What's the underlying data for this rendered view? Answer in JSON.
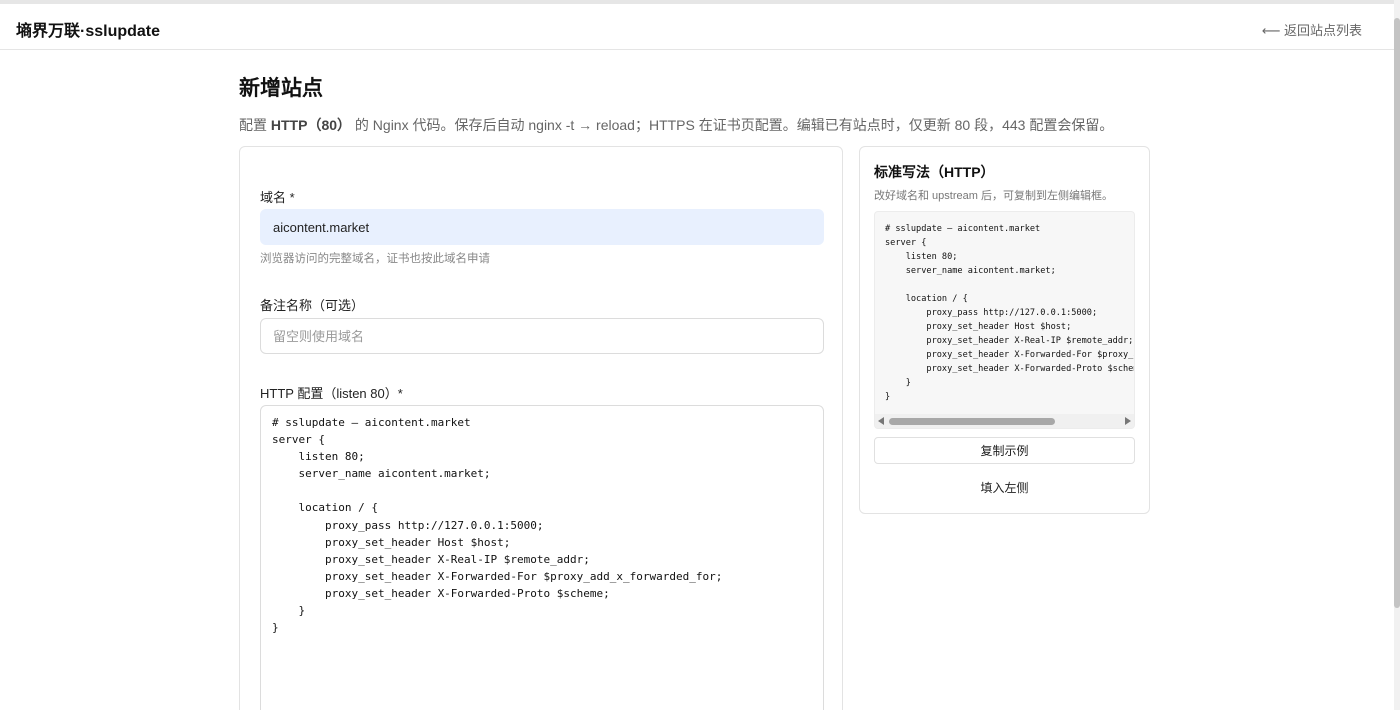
{
  "header": {
    "brand": "墒界万联·sslupdate",
    "back_link": "⟵ 返回站点列表"
  },
  "page": {
    "title": "新增站点",
    "desc_prefix": "配置 ",
    "desc_bold": "HTTP（80）",
    "desc_suffix": " 的 Nginx 代码。保存后自动 nginx -t → reload；HTTPS 在证书页配置。编辑已有站点时，仅更新 80 段，443 配置会保留。"
  },
  "form": {
    "domain": {
      "label": "域名 *",
      "value": "aicontent.market",
      "hint": "浏览器访问的完整域名，证书也按此域名申请"
    },
    "alias": {
      "label": "备注名称（可选）",
      "placeholder": "留空则使用域名",
      "value": ""
    },
    "http_config": {
      "label": "HTTP 配置（listen 80）*",
      "value": "# sslupdate — aicontent.market\nserver {\n    listen 80;\n    server_name aicontent.market;\n\n    location / {\n        proxy_pass http://127.0.0.1:5000;\n        proxy_set_header Host $host;\n        proxy_set_header X-Real-IP $remote_addr;\n        proxy_set_header X-Forwarded-For $proxy_add_x_forwarded_for;\n        proxy_set_header X-Forwarded-Proto $scheme;\n    }\n}"
    }
  },
  "sidebar": {
    "title": "标准写法（HTTP）",
    "desc": "改好域名和 upstream 后，可复制到左侧编辑框。",
    "example": "# sslupdate — aicontent.market\nserver {\n    listen 80;\n    server_name aicontent.market;\n\n    location / {\n        proxy_pass http://127.0.0.1:5000;\n        proxy_set_header Host $host;\n        proxy_set_header X-Real-IP $remote_addr;\n        proxy_set_header X-Forwarded-For $proxy_add_x_forwarded_for;\n        proxy_set_header X-Forwarded-Proto $scheme;\n    }\n}",
    "copy_button": "复制示例",
    "fill_button": "填入左侧"
  }
}
